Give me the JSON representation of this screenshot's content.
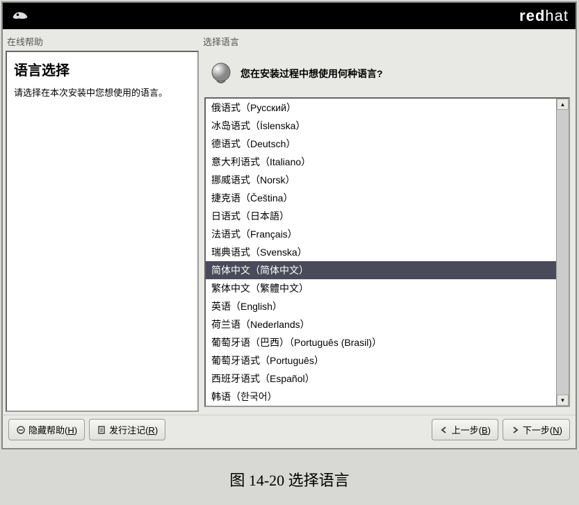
{
  "brand": {
    "bold": "red",
    "light": "hat"
  },
  "left": {
    "panel_label": "在线帮助",
    "help_title": "语言选择",
    "help_text": "请选择在本次安装中您想使用的语言。"
  },
  "right": {
    "panel_label": "选择语言",
    "prompt": "您在安装过程中想使用何种语言?"
  },
  "languages": [
    {
      "label": "俄语式（Русский）",
      "selected": false
    },
    {
      "label": "冰岛语式（Íslenska）",
      "selected": false
    },
    {
      "label": "德语式（Deutsch）",
      "selected": false
    },
    {
      "label": "意大利语式（Italiano）",
      "selected": false
    },
    {
      "label": "挪威语式（Norsk）",
      "selected": false
    },
    {
      "label": "捷克语（Čeština）",
      "selected": false
    },
    {
      "label": "日语式（日本語）",
      "selected": false
    },
    {
      "label": "法语式（Français）",
      "selected": false
    },
    {
      "label": "瑞典语式（Svenska）",
      "selected": false
    },
    {
      "label": "简体中文（简体中文）",
      "selected": true
    },
    {
      "label": "繁体中文（繁體中文）",
      "selected": false
    },
    {
      "label": "英语（English）",
      "selected": false
    },
    {
      "label": "荷兰语（Nederlands）",
      "selected": false
    },
    {
      "label": "葡萄牙语（巴西）（Português (Brasil)）",
      "selected": false
    },
    {
      "label": "葡萄牙语式（Português）",
      "selected": false
    },
    {
      "label": "西班牙语式（Español）",
      "selected": false
    },
    {
      "label": "韩语（한국어）",
      "selected": false
    }
  ],
  "buttons": {
    "hide_help": "隐藏帮助(",
    "hide_help_key": "H",
    "hide_help_end": ")",
    "release_notes": "发行注记(",
    "release_notes_key": "R",
    "release_notes_end": ")",
    "back": "上一步(",
    "back_key": "B",
    "back_end": ")",
    "next": "下一步(",
    "next_key": "N",
    "next_end": ")"
  },
  "caption": "图 14-20  选择语言"
}
